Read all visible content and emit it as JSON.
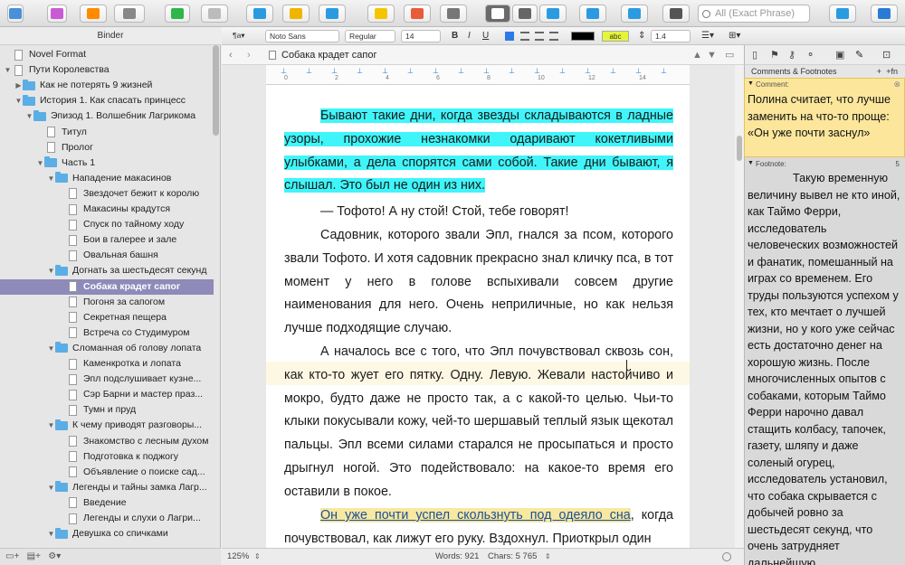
{
  "toolbar": {
    "search_placeholder": "All (Exact Phrase)",
    "icons": [
      "binder-toggle",
      "collections",
      "quick-reference",
      "view-mode",
      "add",
      "trash",
      "inspector",
      "keywords",
      "edit",
      "comment",
      "annotation",
      "footnote",
      "text-view",
      "corkboard",
      "outliner",
      "compile",
      "snapshot",
      "search",
      "quick-search",
      "info"
    ]
  },
  "binder": {
    "title": "Binder",
    "items": [
      {
        "label": "Novel Format",
        "depth": 0,
        "type": "doc",
        "arrow": ""
      },
      {
        "label": "Пути Королевства",
        "depth": 0,
        "type": "doc",
        "arrow": "▼"
      },
      {
        "label": "Как не потерять 9 жизней",
        "depth": 1,
        "type": "folder",
        "arrow": "▶"
      },
      {
        "label": "История 1. Как спасать принцесс",
        "depth": 1,
        "type": "folder",
        "arrow": "▼"
      },
      {
        "label": "Эпизод 1. Волшебник Лагрикома",
        "depth": 2,
        "type": "folder",
        "arrow": "▼"
      },
      {
        "label": "Титул",
        "depth": 3,
        "type": "doc",
        "arrow": ""
      },
      {
        "label": "Пролог",
        "depth": 3,
        "type": "doc",
        "arrow": ""
      },
      {
        "label": "Часть 1",
        "depth": 3,
        "type": "folder",
        "arrow": "▼"
      },
      {
        "label": "Нападение макасинов",
        "depth": 4,
        "type": "folder",
        "arrow": "▼"
      },
      {
        "label": "Звездочет бежит к королю",
        "depth": 5,
        "type": "doc",
        "arrow": ""
      },
      {
        "label": "Макасины крадутся",
        "depth": 5,
        "type": "doc",
        "arrow": ""
      },
      {
        "label": "Спуск по тайному ходу",
        "depth": 5,
        "type": "doc",
        "arrow": ""
      },
      {
        "label": "Бои в галерее и зале",
        "depth": 5,
        "type": "doc",
        "arrow": ""
      },
      {
        "label": "Овальная башня",
        "depth": 5,
        "type": "doc",
        "arrow": ""
      },
      {
        "label": "Догнать за шестьдесят секунд",
        "depth": 4,
        "type": "folder",
        "arrow": "▼"
      },
      {
        "label": "Собака крадет сапог",
        "depth": 5,
        "type": "doc",
        "arrow": "",
        "selected": true
      },
      {
        "label": "Погоня за сапогом",
        "depth": 5,
        "type": "doc",
        "arrow": ""
      },
      {
        "label": "Секретная пещера",
        "depth": 5,
        "type": "doc",
        "arrow": ""
      },
      {
        "label": "Встреча со Студимуром",
        "depth": 5,
        "type": "doc",
        "arrow": ""
      },
      {
        "label": "Сломанная об голову лопата",
        "depth": 4,
        "type": "folder",
        "arrow": "▼"
      },
      {
        "label": "Каменкротка и лопата",
        "depth": 5,
        "type": "doc",
        "arrow": ""
      },
      {
        "label": "Эпл подслушивает кузне...",
        "depth": 5,
        "type": "doc",
        "arrow": ""
      },
      {
        "label": "Сэр Барни и мастер праз...",
        "depth": 5,
        "type": "doc",
        "arrow": ""
      },
      {
        "label": "Тумн и пруд",
        "depth": 5,
        "type": "doc",
        "arrow": ""
      },
      {
        "label": "К чему приводят разговоры...",
        "depth": 4,
        "type": "folder",
        "arrow": "▼"
      },
      {
        "label": "Знакомство с лесным духом",
        "depth": 5,
        "type": "doc",
        "arrow": ""
      },
      {
        "label": "Подготовка к поджогу",
        "depth": 5,
        "type": "doc",
        "arrow": ""
      },
      {
        "label": "Объявление о поиске сад...",
        "depth": 5,
        "type": "doc",
        "arrow": ""
      },
      {
        "label": "Легенды и тайны замка Лагр...",
        "depth": 4,
        "type": "folder",
        "arrow": "▼"
      },
      {
        "label": "Введение",
        "depth": 5,
        "type": "doc",
        "arrow": ""
      },
      {
        "label": "Легенды и слухи о Лагри...",
        "depth": 5,
        "type": "doc",
        "arrow": ""
      },
      {
        "label": "Девушка со спичками",
        "depth": 4,
        "type": "folder",
        "arrow": "▼"
      }
    ]
  },
  "format": {
    "style": "¶a▾",
    "font": "Noto Sans",
    "weight": "Regular",
    "size": "14",
    "bold": "B",
    "italic": "I",
    "underline": "U",
    "highlight": "abc",
    "spacing": "1.4"
  },
  "header": {
    "title": "Собака крадет сапог"
  },
  "ruler": {
    "labels": [
      "0",
      "2",
      "4",
      "6",
      "8",
      "10",
      "12",
      "14"
    ]
  },
  "editor": {
    "paragraphs": [
      {
        "pre": "",
        "hl": "Бывают такие дни, когда звезды складываются в ладные узоры, прохожие незнакомки одаривают кокетливыми улыбками, а дела спорятся сами собой. Такие дни бывают, я слышал. Это был не один из них.",
        "post": ""
      },
      {
        "pre": "— Тофото! А ну стой! Стой, тебе говорят!",
        "hl": "",
        "post": ""
      },
      {
        "pre": "Садовник, которого звали Эпл, гнался за псом, которого звали Тофото. И хотя садовник прекрасно знал кличку пса, в тот момент у него в голове вспыхивали совсем другие наименования для него. Очень неприличные, но как нельзя лучше подходящие случаю.",
        "hl": "",
        "post": ""
      },
      {
        "pre": "А началось все с того, что Эпл почувствовал сквозь сон, как кто-то жует его пятку. Одну. Левую. Жевали настойчиво и мокро, будто даже не просто так, а с какой-то целью. Чьи-то клыки покусывали кожу, чей-то шершавый теплый язык щекотал пальцы. Эпл всеми силами старался не просыпаться и просто дрыгнул ногой. Это подействовало: на какое-то время его оставили в покое.",
        "hl": "",
        "post": ""
      },
      {
        "pre": "",
        "hl": "Он уже почти успел скользнуть под одеяло сна",
        "post": ", когда почувствовал, как лижут его руку. Вздохнул. Приоткрыл один"
      }
    ],
    "zoom": "125%",
    "words": "Words: 921",
    "chars": "Chars: 5 765"
  },
  "inspector": {
    "title": "Comments & Footnotes",
    "comment_label": "Comment:",
    "comment_text": "Полина считает, что лучше заменить на что-то проще: «Он уже почти заснул»",
    "footnote_label": "Footnote:",
    "footnote_number": "5",
    "footnote_text": "Такую временную величину вывел не кто иной, как Таймо Ферри, исследователь человеческих возможностей и фанатик, помешанный на играх со временем. Его труды пользуются успехом у тех, кто мечтает о лучшей жизни, но у кого уже сейчас есть достаточно денег на хорошую жизнь. После многочисленных опытов с собаками, которым Таймо Ферри нарочно давал стащить колбасу, тапочек, газету, шляпу и даже соленый огурец, исследователь установил, что собака скрывается с добычей ровно за шестьдесят секунд, что очень затрудняет дальнейшую"
  },
  "colors": {
    "selection": "#8e8ab9",
    "cyan_highlight": "#3ff5fa",
    "comment_bg": "#fbe69b",
    "folder": "#5aaee5"
  }
}
